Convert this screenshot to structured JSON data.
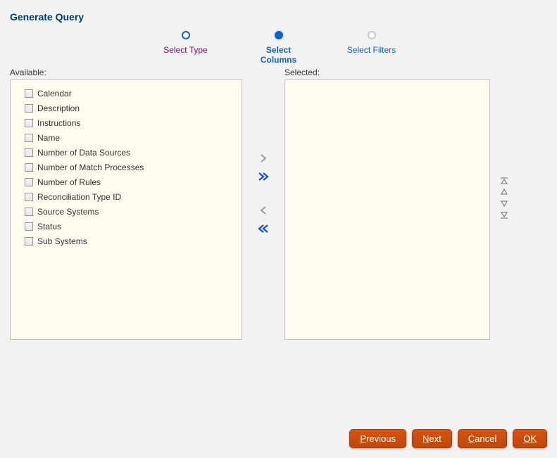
{
  "title": "Generate Query",
  "steps": [
    {
      "label": "Select Type",
      "state": "past"
    },
    {
      "label": "Select Columns",
      "state": "current"
    },
    {
      "label": "Select Filters",
      "state": "future"
    }
  ],
  "labels": {
    "available": "Available:",
    "selected": "Selected:"
  },
  "available_items": [
    "Calendar",
    "Description",
    "Instructions",
    "Name",
    "Number of Data Sources",
    "Number of Match Processes",
    "Number of Rules",
    "Reconciliation Type ID",
    "Source Systems",
    "Status",
    "Sub Systems"
  ],
  "selected_items": [],
  "buttons": {
    "previous": "Previous",
    "next": "Next",
    "cancel": "Cancel",
    "ok": "OK"
  },
  "icons": {
    "move_right": "chevron-right-icon",
    "move_all_right": "double-chevron-right-icon",
    "move_left": "chevron-left-icon",
    "move_all_left": "double-chevron-left-icon",
    "move_top": "move-top-icon",
    "move_up": "move-up-icon",
    "move_down": "move-down-icon",
    "move_bottom": "move-bottom-icon"
  },
  "colors": {
    "brand_blue": "#0a62c9",
    "visited_purple": "#7a0b8c",
    "action_orange": "#bf470b",
    "panel_bg": "#fdfcee"
  }
}
